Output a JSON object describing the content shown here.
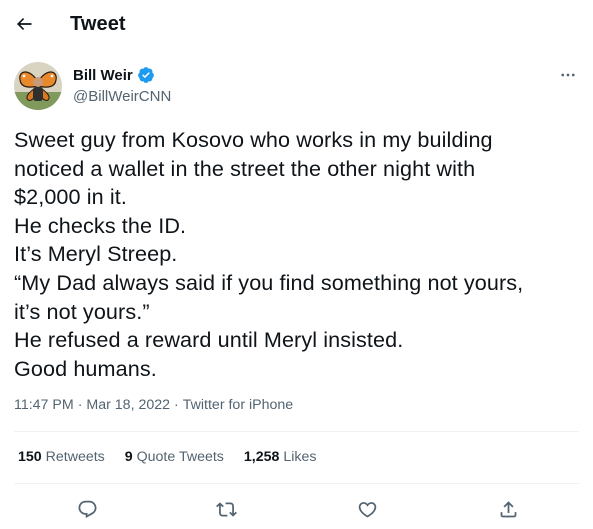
{
  "header": {
    "title": "Tweet",
    "back_icon": "arrow-left-icon"
  },
  "author": {
    "display_name": "Bill Weir",
    "handle": "@BillWeirCNN",
    "verified_icon": "verified-badge-icon",
    "verified_color": "#1d9bf0",
    "more_icon": "more-horizontal-icon"
  },
  "tweet": {
    "text": "Sweet guy from Kosovo who works in my building\nnoticed a wallet in the street the other night with\n$2,000 in it.\nHe checks the ID.\nIt’s Meryl Streep.\n“My Dad always said if you find something not yours,\nit’s not yours.”\nHe refused a reward until Meryl insisted.\nGood humans."
  },
  "meta": {
    "time": "11:47 PM",
    "date": "Mar 18, 2022",
    "source": "Twitter for iPhone",
    "separator": "·"
  },
  "stats": {
    "retweets_count": "150",
    "retweets_label": "Retweets",
    "quotes_count": "9",
    "quotes_label": "Quote Tweets",
    "likes_count": "1,258",
    "likes_label": "Likes"
  },
  "actions": {
    "reply_icon": "reply-icon",
    "retweet_icon": "retweet-icon",
    "like_icon": "heart-icon",
    "share_icon": "share-icon"
  },
  "colors": {
    "text": "#0f1419",
    "secondary": "#536471",
    "divider": "#eff3f4",
    "accent": "#1d9bf0"
  }
}
